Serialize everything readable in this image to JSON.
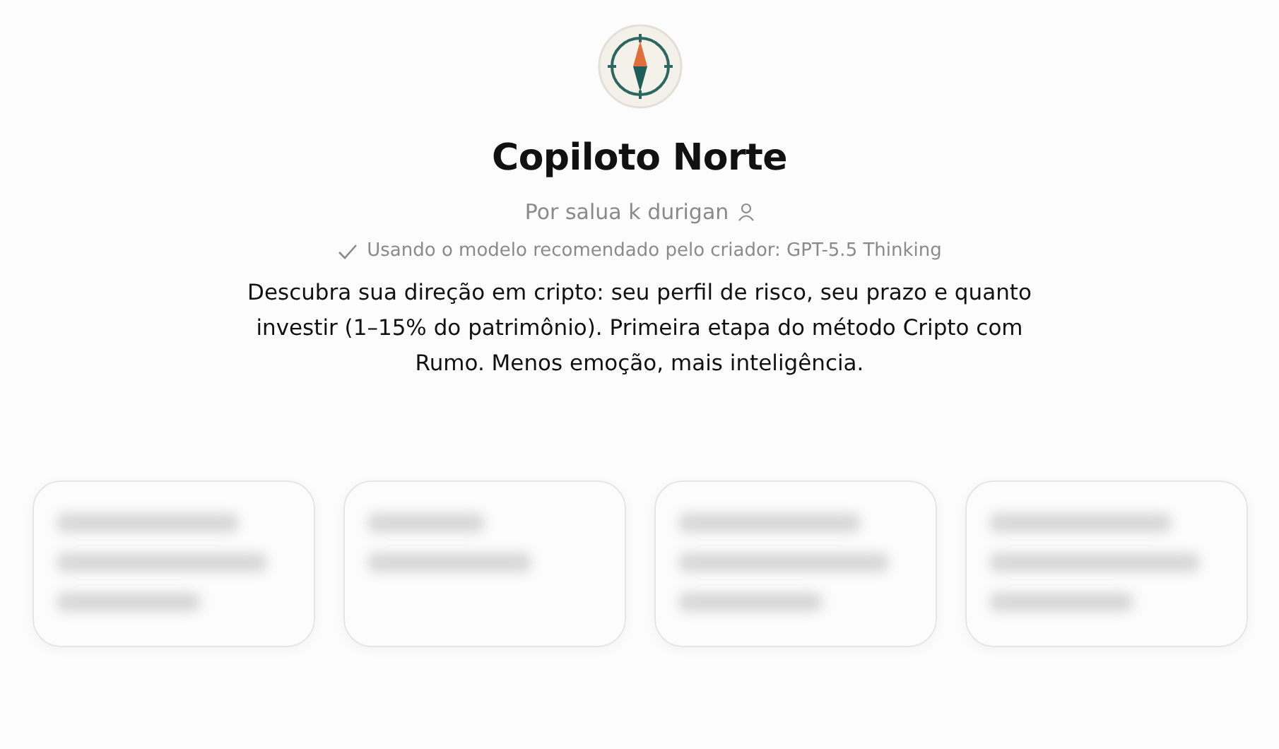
{
  "gpt": {
    "name": "Copiloto Norte",
    "author": "Por salua k durigan",
    "model_note": "Usando o modelo recomendado pelo criador: GPT-5.5 Thinking",
    "description": "Descubra sua direção em cripto: seu perfil de risco, seu prazo e quanto investir (1–15% do patrimônio). Primeira etapa do método Cripto com Rumo. Menos emoção, mais inteligência."
  },
  "starter_cards": [
    {
      "kind": "three-line"
    },
    {
      "kind": "two-line"
    },
    {
      "kind": "three-line"
    },
    {
      "kind": "three-line"
    }
  ]
}
